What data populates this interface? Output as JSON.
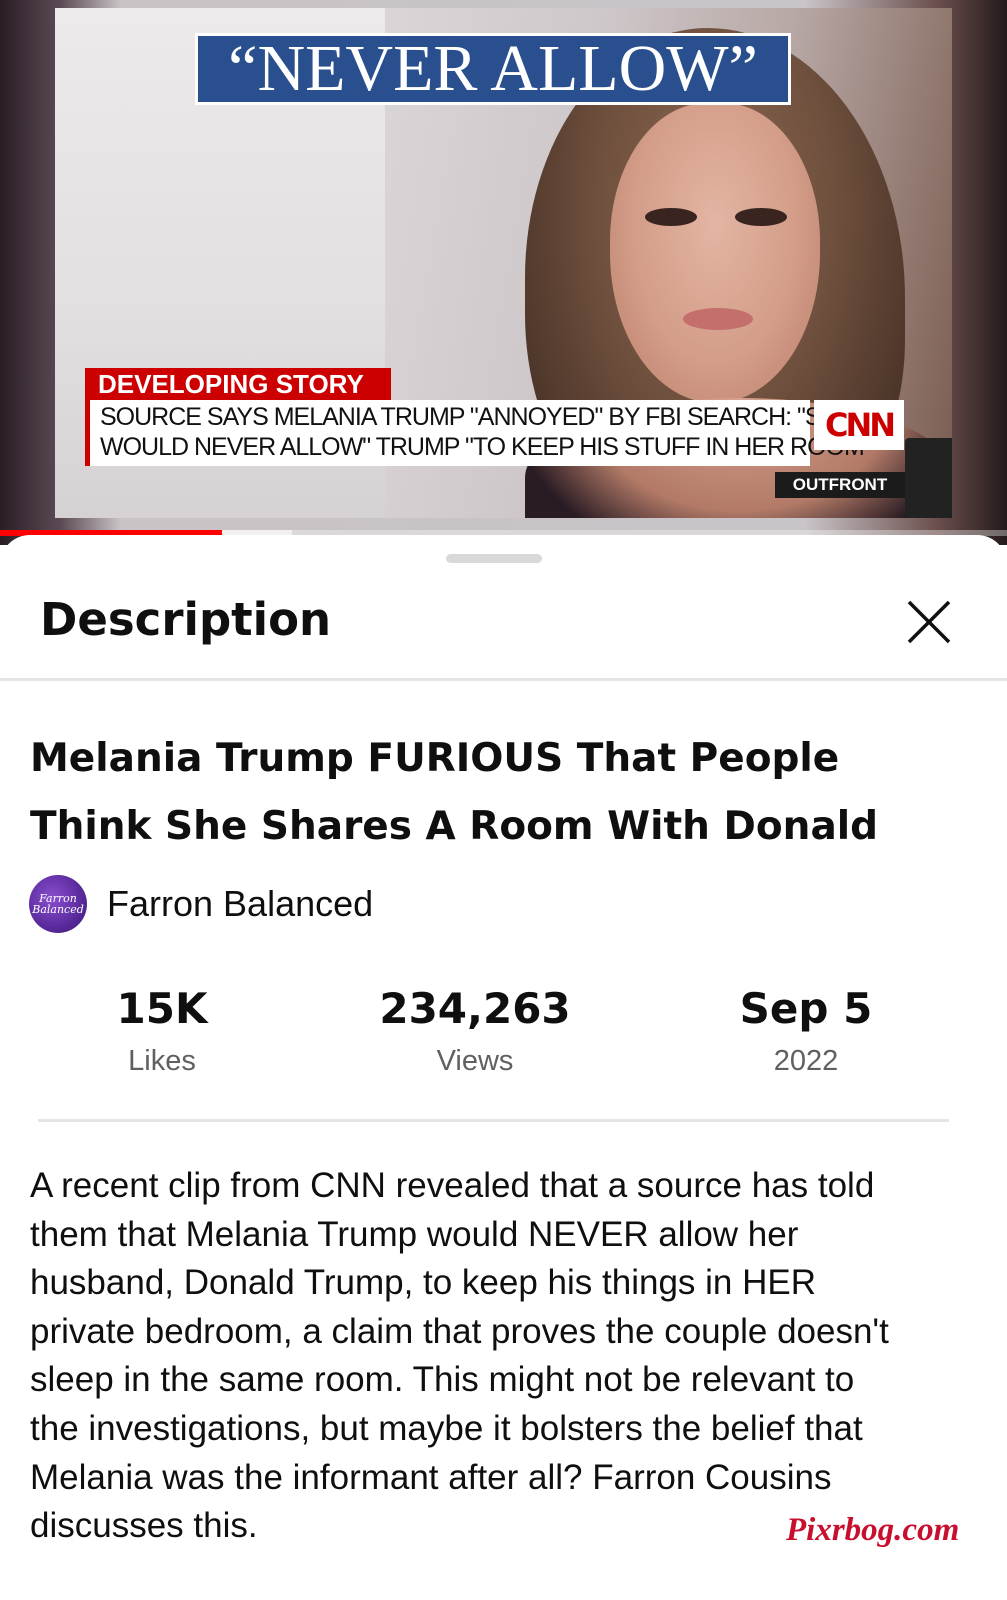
{
  "video": {
    "banner_text": "“NEVER ALLOW”",
    "chyron_tag": "DEVELOPING STORY",
    "chyron_lines": [
      "SOURCE SAYS MELANIA TRUMP \"ANNOYED\" BY FBI SEARCH: \"SHE",
      "WOULD NEVER ALLOW\" TRUMP \"TO KEEP HIS STUFF IN HER ROOM\""
    ],
    "network_logo": "CNN",
    "show_name": "OUTFRONT",
    "progress_fraction": 0.22,
    "buffered_fraction": 0.29,
    "progress_color": "#ff0000"
  },
  "sheet": {
    "title": "Description",
    "close_icon": "close-icon"
  },
  "video_title": "Melania Trump FURIOUS That People Think She Shares A Room With Donald",
  "channel": {
    "name": "Farron Balanced",
    "avatar_text": "Farron Balanced"
  },
  "stats": {
    "likes": {
      "value": "15K",
      "label": "Likes"
    },
    "views": {
      "value": "234,263",
      "label": "Views"
    },
    "date": {
      "value": "Sep 5",
      "label": "2022"
    }
  },
  "description_lines": [
    "A recent clip from CNN revealed that a source has told",
    "them that Melania Trump would NEVER allow her",
    "husband, Donald Trump, to keep his things in HER",
    "private bedroom, a claim that proves the couple doesn't",
    "sleep in the same room. This might not be relevant to",
    "the investigations, but maybe it bolsters the belief that",
    "Melania was the informant after all? Farron Cousins",
    "discusses this."
  ],
  "watermark": "Pixrbog.com",
  "colors": {
    "accent_red": "#cc0000",
    "banner_blue": "#2a4f8f",
    "watermark_red": "#c8102e"
  }
}
